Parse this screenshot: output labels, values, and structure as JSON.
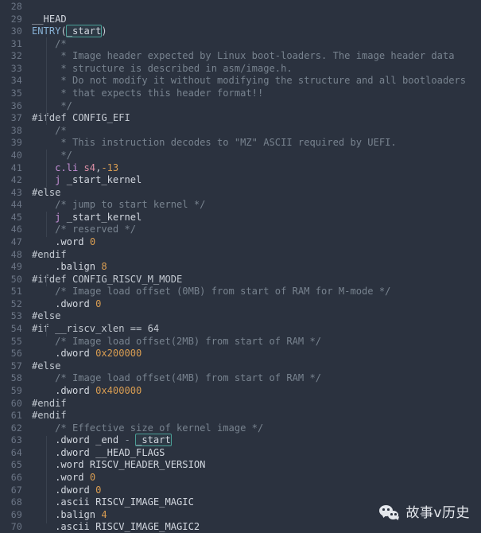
{
  "editor": {
    "file_language": "riscv-assembly",
    "first_line_number": 28,
    "colors": {
      "background": "#2b323f",
      "line_number": "#6c7686",
      "default_text": "#d2d7df",
      "comment": "#78838f",
      "preprocessor": "#c3c9d1",
      "function": "#86b0d4",
      "instruction": "#c58fd6",
      "register": "#dd8fa6",
      "number": "#d99d52",
      "occurrence_highlight_border": "#4a9e96"
    },
    "lines": [
      {
        "n": 28,
        "text": ""
      },
      {
        "n": 29,
        "text": "__HEAD"
      },
      {
        "n": 30,
        "text": "ENTRY(_start)"
      },
      {
        "n": 31,
        "text": "    /*"
      },
      {
        "n": 32,
        "text": "     * Image header expected by Linux boot-loaders. The image header data"
      },
      {
        "n": 33,
        "text": "     * structure is described in asm/image.h."
      },
      {
        "n": 34,
        "text": "     * Do not modify it without modifying the structure and all bootloaders"
      },
      {
        "n": 35,
        "text": "     * that expects this header format!!"
      },
      {
        "n": 36,
        "text": "     */"
      },
      {
        "n": 37,
        "text": "#ifdef CONFIG_EFI"
      },
      {
        "n": 38,
        "text": "    /*"
      },
      {
        "n": 39,
        "text": "     * This instruction decodes to \"MZ\" ASCII required by UEFI."
      },
      {
        "n": 40,
        "text": "     */"
      },
      {
        "n": 41,
        "text": "    c.li s4,-13"
      },
      {
        "n": 42,
        "text": "    j _start_kernel"
      },
      {
        "n": 43,
        "text": "#else"
      },
      {
        "n": 44,
        "text": "    /* jump to start kernel */"
      },
      {
        "n": 45,
        "text": "    j _start_kernel"
      },
      {
        "n": 46,
        "text": "    /* reserved */"
      },
      {
        "n": 47,
        "text": "    .word 0"
      },
      {
        "n": 48,
        "text": "#endif"
      },
      {
        "n": 49,
        "text": "    .balign 8"
      },
      {
        "n": 50,
        "text": "#ifdef CONFIG_RISCV_M_MODE"
      },
      {
        "n": 51,
        "text": "    /* Image load offset (0MB) from start of RAM for M-mode */"
      },
      {
        "n": 52,
        "text": "    .dword 0"
      },
      {
        "n": 53,
        "text": "#else"
      },
      {
        "n": 54,
        "text": "#if __riscv_xlen == 64"
      },
      {
        "n": 55,
        "text": "    /* Image load offset(2MB) from start of RAM */"
      },
      {
        "n": 56,
        "text": "    .dword 0x200000"
      },
      {
        "n": 57,
        "text": "#else"
      },
      {
        "n": 58,
        "text": "    /* Image load offset(4MB) from start of RAM */"
      },
      {
        "n": 59,
        "text": "    .dword 0x400000"
      },
      {
        "n": 60,
        "text": "#endif"
      },
      {
        "n": 61,
        "text": "#endif"
      },
      {
        "n": 62,
        "text": "    /* Effective size of kernel image */"
      },
      {
        "n": 63,
        "text": "    .dword _end - _start"
      },
      {
        "n": 64,
        "text": "    .dword __HEAD_FLAGS"
      },
      {
        "n": 65,
        "text": "    .word RISCV_HEADER_VERSION"
      },
      {
        "n": 66,
        "text": "    .word 0"
      },
      {
        "n": 67,
        "text": "    .dword 0"
      },
      {
        "n": 68,
        "text": "    .ascii RISCV_IMAGE_MAGIC"
      },
      {
        "n": 69,
        "text": "    .balign 4"
      },
      {
        "n": 70,
        "text": "    .ascii RISCV_IMAGE_MAGIC2"
      }
    ],
    "occurrence_highlights": [
      {
        "line": 30,
        "token": "_start"
      },
      {
        "line": 63,
        "token": "_start"
      }
    ]
  },
  "watermark": {
    "logo_icon": "wechat-logo-icon",
    "text": "故事v历史"
  }
}
